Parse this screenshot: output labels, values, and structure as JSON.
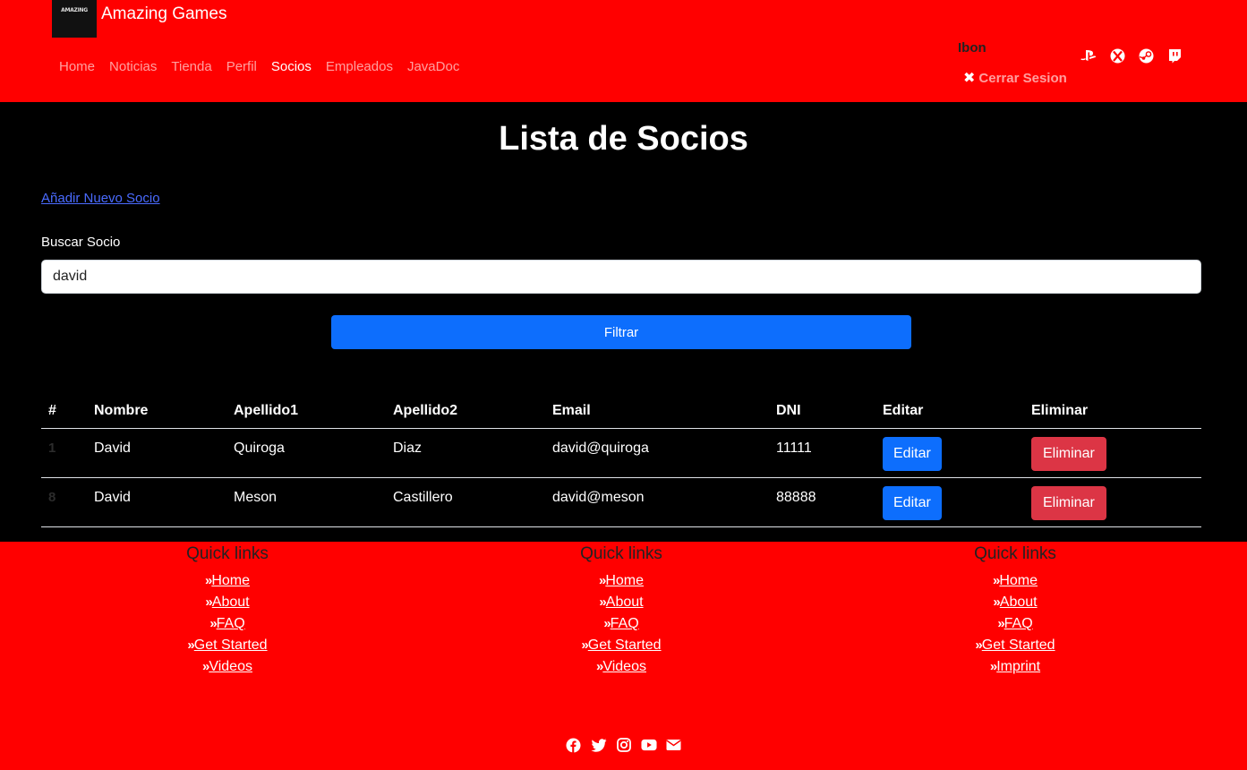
{
  "header": {
    "brand_logo_text": "AMAZING",
    "brand_name": "Amazing Games",
    "nav": [
      {
        "label": "Home",
        "active": false
      },
      {
        "label": "Noticias",
        "active": false
      },
      {
        "label": "Tienda",
        "active": false
      },
      {
        "label": "Perfil",
        "active": false
      },
      {
        "label": "Socios",
        "active": true
      },
      {
        "label": "Empleados",
        "active": false
      },
      {
        "label": "JavaDoc",
        "active": false
      }
    ],
    "user_name": "Ibon",
    "logout_label": "Cerrar Sesion",
    "social_icons": [
      "playstation-icon",
      "xbox-icon",
      "steam-icon",
      "twitch-icon"
    ]
  },
  "main": {
    "title": "Lista de Socios",
    "add_link": "Añadir Nuevo Socio",
    "search_label": "Buscar Socio",
    "search_value": "david",
    "filter_label": "Filtrar"
  },
  "table": {
    "headers": [
      "#",
      "Nombre",
      "Apellido1",
      "Apellido2",
      "Email",
      "DNI",
      "Editar",
      "Eliminar"
    ],
    "rows": [
      {
        "id": "1",
        "nombre": "David",
        "apellido1": "Quiroga",
        "apellido2": "Diaz",
        "email": "david@quiroga",
        "dni": "11111",
        "edit": "Editar",
        "delete": "Eliminar"
      },
      {
        "id": "8",
        "nombre": "David",
        "apellido1": "Meson",
        "apellido2": "Castillero",
        "email": "david@meson",
        "dni": "88888",
        "edit": "Editar",
        "delete": "Eliminar"
      }
    ]
  },
  "footer": {
    "columns": [
      {
        "title": "Quick links",
        "links": [
          "Home",
          "About",
          "FAQ",
          "Get Started",
          "Videos"
        ]
      },
      {
        "title": "Quick links",
        "links": [
          "Home",
          "About",
          "FAQ",
          "Get Started",
          "Videos"
        ]
      },
      {
        "title": "Quick links",
        "links": [
          "Home",
          "About",
          "FAQ",
          "Get Started",
          "Imprint"
        ]
      }
    ],
    "social_icons": [
      "facebook-icon",
      "twitter-icon",
      "instagram-icon",
      "youtube-icon",
      "email-icon"
    ]
  },
  "colors": {
    "header_bg": "#ff0000",
    "main_bg": "#000000",
    "primary": "#0d6efd",
    "danger": "#dc3545",
    "link": "#4a6bff"
  }
}
